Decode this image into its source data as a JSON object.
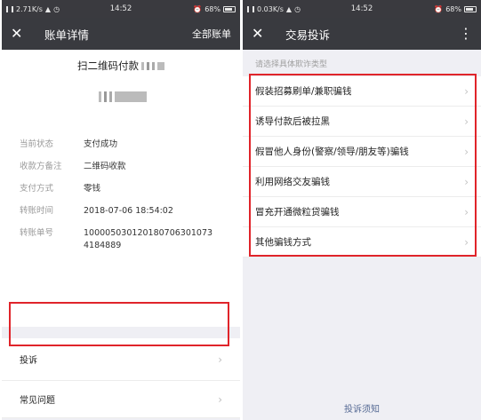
{
  "left": {
    "statusbar": {
      "net": "2.71K/s",
      "time": "14:52",
      "battery": "68%"
    },
    "navbar": {
      "title": "账单详情",
      "action": "全部账单"
    },
    "bill": {
      "title": "扫二维码付款",
      "rows": [
        {
          "label": "当前状态",
          "value": "支付成功"
        },
        {
          "label": "收款方备注",
          "value": "二维码收款"
        },
        {
          "label": "支付方式",
          "value": "零钱"
        },
        {
          "label": "转账时间",
          "value": "2018-07-06 18:54:02"
        },
        {
          "label": "转账单号",
          "value": "1000050301201807063010734184889"
        }
      ]
    },
    "list": {
      "complaint": "投诉",
      "faq": "常见问题"
    }
  },
  "right": {
    "statusbar": {
      "net": "0.03K/s",
      "time": "14:52",
      "battery": "68%"
    },
    "navbar": {
      "title": "交易投诉"
    },
    "hint": "请选择具体欺诈类型",
    "reasons": [
      "假装招募刷单/兼职骗钱",
      "诱导付款后被拉黑",
      "假冒他人身份(警察/领导/朋友等)骗钱",
      "利用网络交友骗钱",
      "冒充开通微粒贷骗钱",
      "其他骗钱方式"
    ],
    "notice": "投诉须知"
  },
  "icons": {
    "close": "close-icon",
    "chevron": "chevron-right-icon",
    "more": "more-vertical-icon"
  },
  "colors": {
    "highlight": "#e0242a",
    "navbar": "#393a3f",
    "link": "#576b95"
  }
}
